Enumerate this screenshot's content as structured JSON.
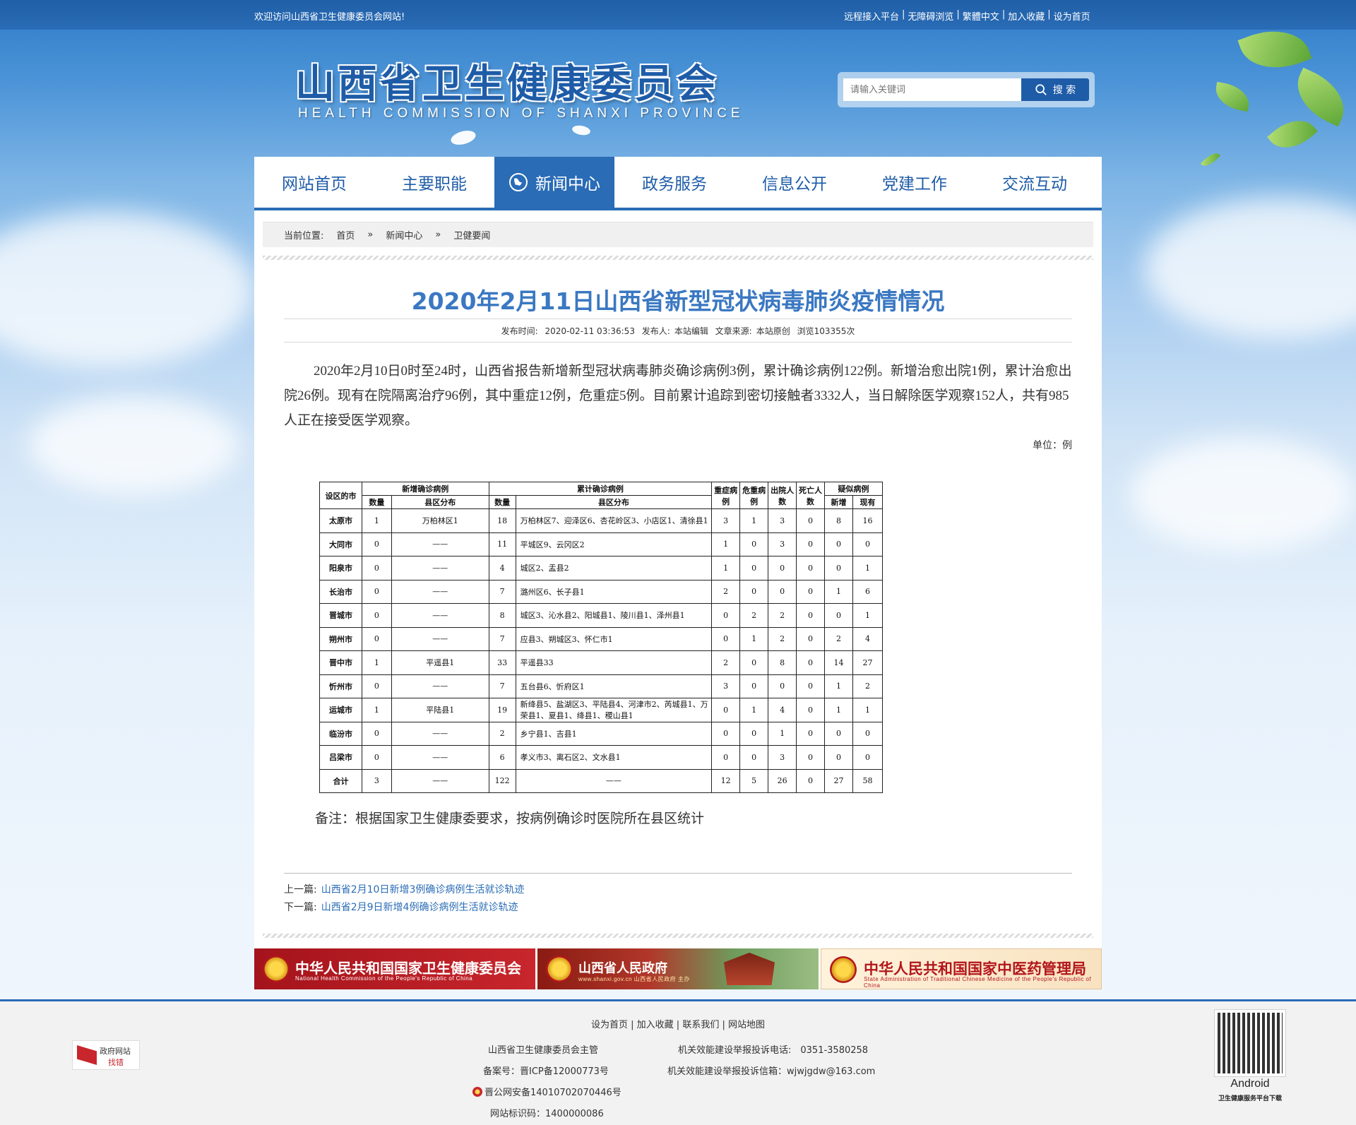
{
  "topbar": {
    "welcome": "欢迎访问山西省卫生健康委员会网站!",
    "links": [
      "远程接入平台",
      "无障碍浏览",
      "繁體中文",
      "加入收藏",
      "设为首页"
    ]
  },
  "header": {
    "title_cn": "山西省卫生健康委员会",
    "title_en": "HEALTH COMMISSION OF SHANXI PROVINCE"
  },
  "search": {
    "placeholder": "请输入关键词",
    "button": "搜 索"
  },
  "nav": {
    "items": [
      "网站首页",
      "主要职能",
      "新闻中心",
      "政务服务",
      "信息公开",
      "党建工作",
      "交流互动"
    ],
    "active": "新闻中心"
  },
  "breadcrumb": {
    "prefix": "当前位置:",
    "items": [
      "首页",
      "新闻中心",
      "卫健要闻"
    ],
    "sep": "»"
  },
  "article": {
    "title": "2020年2月11日山西省新型冠状病毒肺炎疫情情况",
    "meta": {
      "time_label": "发布时间:",
      "time": "2020-02-11 03:36:53",
      "publisher_label": "发布人:",
      "publisher": "本站编辑",
      "source_label": "文章来源:",
      "source": "本站原创",
      "views": "浏览103355次"
    },
    "body": "2020年2月10日0时至24时，山西省报告新增新型冠状病毒肺炎确诊病例3例，累计确诊病例122例。新增治愈出院1例，累计治愈出院26例。现有在院隔离治疗96例，其中重症12例，危重症5例。目前累计追踪到密切接触者3332人，当日解除医学观察152人，共有985人正在接受医学观察。",
    "unit": "单位：例",
    "note": "备注：根据国家卫生健康委要求，按病例确诊时医院所在县区统计"
  },
  "table": {
    "header": {
      "city": "设区的市",
      "new_group": "新增确诊病例",
      "total_group": "累计确诊病例",
      "severe": "重症病例",
      "critical": "危重病例",
      "discharged": "出院人数",
      "deaths": "死亡人数",
      "suspected_group": "疑似病例",
      "count": "数量",
      "district": "县区分布",
      "sus_new": "新增",
      "sus_current": "现有"
    },
    "rows": [
      [
        "太原市",
        "1",
        "万柏林区1",
        "18",
        "万柏林区7、迎泽区6、杏花岭区3、小店区1、清徐县1",
        "3",
        "1",
        "3",
        "0",
        "8",
        "16"
      ],
      [
        "大同市",
        "0",
        "——",
        "11",
        "平城区9、云冈区2",
        "1",
        "0",
        "3",
        "0",
        "0",
        "0"
      ],
      [
        "阳泉市",
        "0",
        "——",
        "4",
        "城区2、盂县2",
        "1",
        "0",
        "0",
        "0",
        "0",
        "1"
      ],
      [
        "长治市",
        "0",
        "——",
        "7",
        "潞州区6、长子县1",
        "2",
        "0",
        "0",
        "0",
        "1",
        "6"
      ],
      [
        "晋城市",
        "0",
        "——",
        "8",
        "城区3、沁水县2、阳城县1、陵川县1、泽州县1",
        "0",
        "2",
        "2",
        "0",
        "0",
        "1"
      ],
      [
        "朔州市",
        "0",
        "——",
        "7",
        "应县3、朔城区3、怀仁市1",
        "0",
        "1",
        "2",
        "0",
        "2",
        "4"
      ],
      [
        "晋中市",
        "1",
        "平遥县1",
        "33",
        "平遥县33",
        "2",
        "0",
        "8",
        "0",
        "14",
        "27"
      ],
      [
        "忻州市",
        "0",
        "——",
        "7",
        "五台县6、忻府区1",
        "3",
        "0",
        "0",
        "0",
        "1",
        "2"
      ],
      [
        "运城市",
        "1",
        "平陆县1",
        "19",
        "新绛县5、盐湖区3、平陆县4、河津市2、芮城县1、万荣县1、夏县1、绛县1、稷山县1",
        "0",
        "1",
        "4",
        "0",
        "1",
        "1"
      ],
      [
        "临汾市",
        "0",
        "——",
        "2",
        "乡宁县1、吉县1",
        "0",
        "0",
        "1",
        "0",
        "0",
        "0"
      ],
      [
        "吕梁市",
        "0",
        "——",
        "6",
        "孝义市3、离石区2、文水县1",
        "0",
        "0",
        "3",
        "0",
        "0",
        "0"
      ],
      [
        "合计",
        "3",
        "——",
        "122",
        "——",
        "12",
        "5",
        "26",
        "0",
        "27",
        "58"
      ]
    ]
  },
  "prevnext": {
    "prev_label": "上一篇:",
    "prev": "山西省2月10日新增3例确诊病例生活就诊轨迹",
    "next_label": "下一篇:",
    "next": "山西省2月9日新增4例确诊病例生活就诊轨迹"
  },
  "banners": [
    {
      "title": "中华人民共和国国家卫生健康委员会",
      "sub": "National Health Commission of the People's Republic of China",
      "icon": "national-emblem-icon"
    },
    {
      "title": "山西省人民政府",
      "sub": "www.shanxi.gov.cn  山西省人民政府 主办",
      "icon": "national-emblem-icon"
    },
    {
      "title": "中华人民共和国国家中医药管理局",
      "sub": "State Administration of Traditional Chinese Medicine of the People's Republic of China",
      "icon": "national-emblem-icon"
    }
  ],
  "footer": {
    "links": [
      "设为首页",
      "加入收藏",
      "联系我们",
      "网站地图"
    ],
    "sponsor": "山西省卫生健康委员会主管",
    "complaint_phone": "机关效能建设举报投诉电话:　0351-3580258",
    "icp": "备案号：晋ICP备12000773号",
    "complaint_email": "机关效能建设举报投诉信箱：wjwjgdw@163.com",
    "police": "晋公网安备14010702070446号",
    "site_id": "网站标识码：1400000086",
    "gov_badge_1": "政府网站",
    "gov_badge_2": "找错",
    "qr_label": "Android",
    "qr_sub": "卫生健康服务平台下载"
  }
}
